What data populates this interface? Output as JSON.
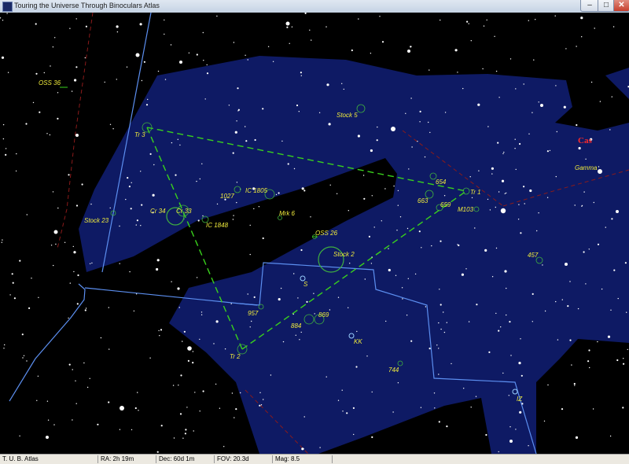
{
  "window": {
    "title": "Touring the Universe Through Binoculars Atlas",
    "buttons": {
      "minimize": "–",
      "maximize": "□",
      "close": "✕"
    }
  },
  "chart": {
    "constellation_label": "Cas",
    "objects": {
      "oss36": "OSS 36",
      "stock5": "Stock 5",
      "tr3": "Tr 3",
      "cas_gamma": "Gamma",
      "n654": "654",
      "tr1": "Tr 1",
      "n663": "663",
      "n659": "659",
      "m103": "M103",
      "n1027": "1027",
      "ic1805": "IC 1805",
      "cr34": "Cr 34",
      "cr33": "Cr 33",
      "ic1848": "IC 1848",
      "stock23": "Stock 23",
      "mrk6": "Mrk 6",
      "oss26": "OSS 26",
      "stock2": "Stock 2",
      "n457": "457",
      "s": "S",
      "n957": "957",
      "n869": "869",
      "n884": "884",
      "kk": "KK",
      "tr2": "Tr 2",
      "n744": "744",
      "iz": "IZ"
    }
  },
  "statusbar": {
    "atlas": "T. U. B. Atlas",
    "ra": "RA: 2h 19m",
    "dec": "Dec: 60d 1m",
    "fov": "FOV: 20.3d",
    "mag": "Mag: 8.5"
  },
  "colors": {
    "sky": "#000000",
    "milky_way": "#0e1a64",
    "label": "#f1ec3c",
    "constellation": "#ff2a2a",
    "asterism": "#39d21c",
    "boundary": "#5c8ff0"
  }
}
